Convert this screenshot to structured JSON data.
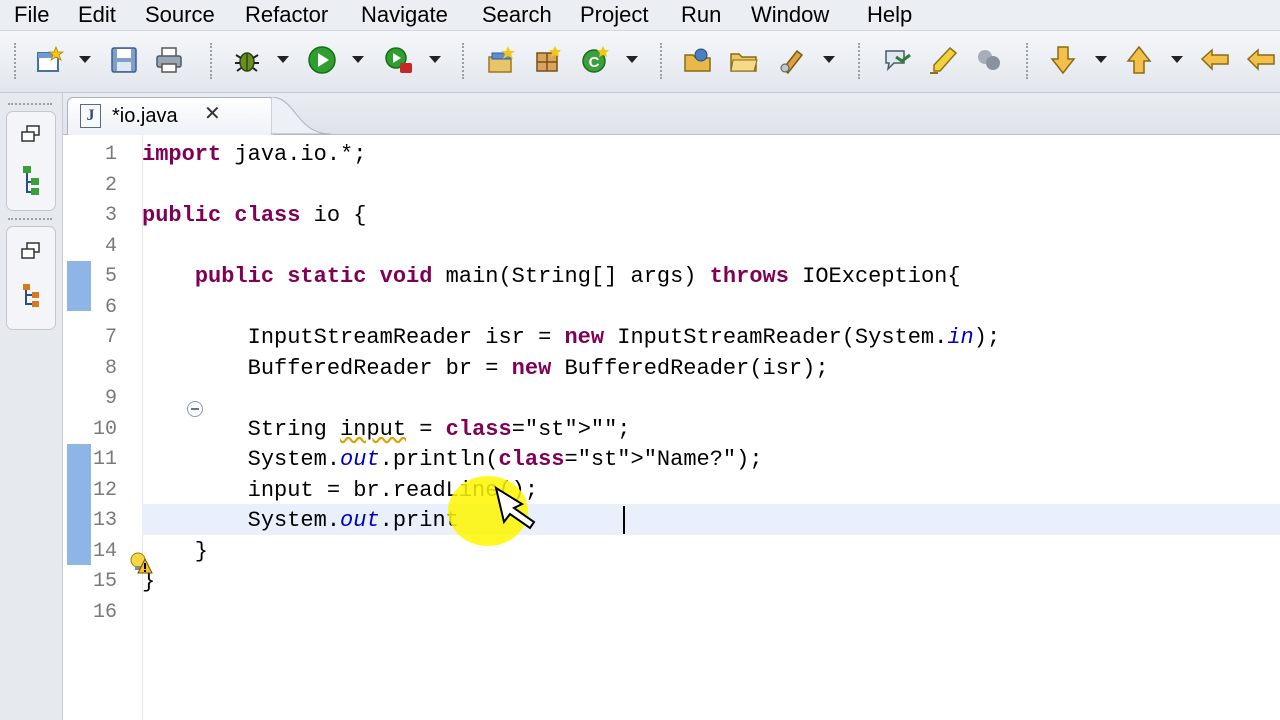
{
  "menu": [
    "File",
    "Edit",
    "Source",
    "Refactor",
    "Navigate",
    "Search",
    "Project",
    "Run",
    "Window",
    "Help"
  ],
  "toolbar": {
    "icons": [
      "new-wizard-icon",
      "save-icon",
      "print-icon",
      "debug-icon",
      "run-icon",
      "run-external-icon",
      "new-java-project-icon",
      "new-package-icon",
      "new-class-icon",
      "open-type-icon",
      "open-resource-icon",
      "search-icon",
      "toggle-annotations-icon",
      "highlighter-icon",
      "breakpoint-icon",
      "next-annotation-icon",
      "previous-annotation-icon",
      "back-icon",
      "forward-icon"
    ]
  },
  "editor": {
    "tab_label": "*io.java",
    "tab_close": "✕",
    "line_numbers": [
      "1",
      "2",
      "3",
      "4",
      "5",
      "6",
      "7",
      "8",
      "9",
      "10",
      "11",
      "12",
      "13",
      "14",
      "15",
      "16"
    ],
    "lines": [
      "import java.io.*;",
      "",
      "public class io {",
      "",
      "    public static void main(String[] args) throws IOException{",
      "",
      "        InputStreamReader isr = new InputStreamReader(System.in);",
      "        BufferedReader br = new BufferedReader(isr);",
      "",
      "        String input = \"\";",
      "        System.out.println(\"Name?\");",
      "        input = br.readLine();",
      "        System.out.print",
      "    }",
      "}",
      ""
    ],
    "current_line": 13
  },
  "colors": {
    "keyword": "#7f0055",
    "string": "#2a00ff",
    "static_field": "#0000c0",
    "change_bar": "#8fb5e6",
    "current_line": "#e9f0fb",
    "cursor_highlight": "#fff600"
  }
}
